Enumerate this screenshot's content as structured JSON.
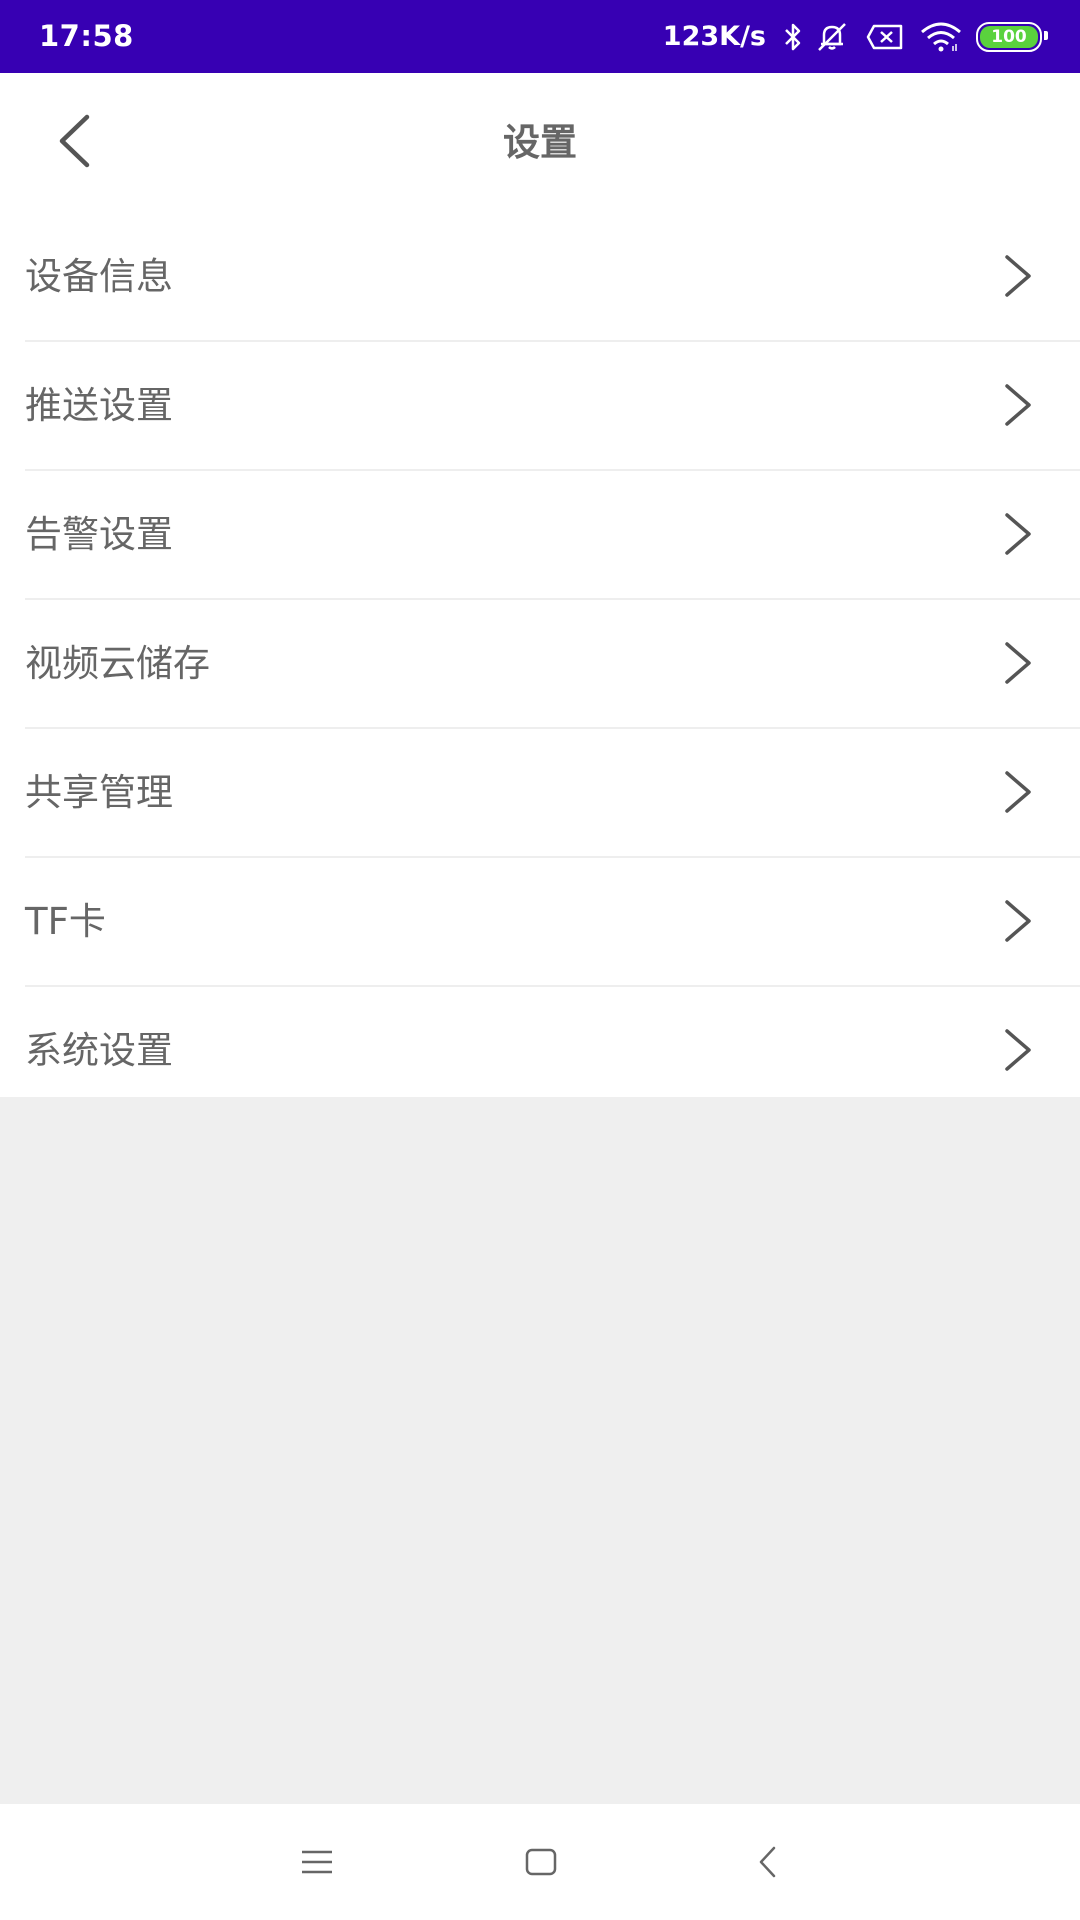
{
  "status_bar": {
    "time": "17:58",
    "network_speed": "123K/s",
    "battery_level": "100",
    "icons": [
      "bluetooth-icon",
      "mute-bell-icon",
      "sim-off-icon",
      "wifi-icon",
      "battery-icon"
    ],
    "background_color": "#3700b3",
    "battery_color": "#5ad23d"
  },
  "header": {
    "title": "设置",
    "back_icon": "chevron-left-icon"
  },
  "menu": {
    "items": [
      {
        "label": "设备信息"
      },
      {
        "label": "推送设置"
      },
      {
        "label": "告警设置"
      },
      {
        "label": "视频云储存"
      },
      {
        "label": "共享管理"
      },
      {
        "label": "TF卡"
      },
      {
        "label": "系统设置"
      }
    ],
    "arrow_icon": "chevron-right-icon",
    "text_color": "#666666"
  },
  "nav_bar": {
    "icons": [
      "menu-icon",
      "home-icon",
      "back-icon"
    ]
  }
}
